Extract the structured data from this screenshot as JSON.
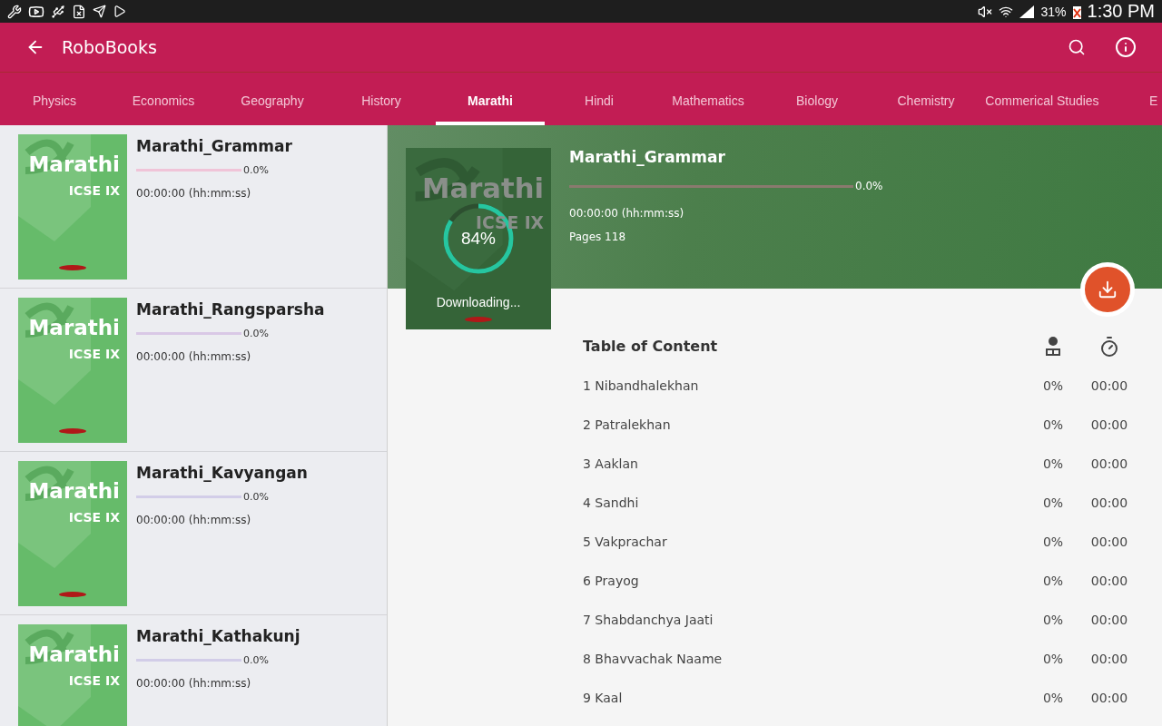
{
  "status_bar": {
    "battery": "31%",
    "time": "1:30 PM"
  },
  "app_bar": {
    "title": "RoboBooks"
  },
  "tabs": [
    {
      "label": "Physics",
      "selected": false
    },
    {
      "label": "Economics",
      "selected": false
    },
    {
      "label": "Geography",
      "selected": false
    },
    {
      "label": "History",
      "selected": false
    },
    {
      "label": "Marathi",
      "selected": true
    },
    {
      "label": "Hindi",
      "selected": false
    },
    {
      "label": "Mathematics",
      "selected": false
    },
    {
      "label": "Biology",
      "selected": false
    },
    {
      "label": "Chemistry",
      "selected": false
    },
    {
      "label": "Commerical Studies",
      "selected": false
    },
    {
      "label": "E",
      "selected": false
    }
  ],
  "books": [
    {
      "title": "Marathi_Grammar",
      "cover_title": "Marathi",
      "cover_subtitle": "ICSE IX",
      "level": 0,
      "progress": "0.0%",
      "color": "#f0c4d8",
      "time": "00:00:00 (hh:mm:ss)"
    },
    {
      "title": "Marathi_Rangsparsha",
      "cover_title": "Marathi",
      "cover_subtitle": "ICSE IX",
      "level": 0,
      "progress": "0.0%",
      "color": "#d9c8e6",
      "time": "00:00:00 (hh:mm:ss)"
    },
    {
      "title": "Marathi_Kavyangan",
      "cover_title": "Marathi",
      "cover_subtitle": "ICSE IX",
      "level": 0,
      "progress": "0.0%",
      "color": "#d2cde8",
      "time": "00:00:00 (hh:mm:ss)"
    },
    {
      "title": "Marathi_Kathakunj",
      "cover_title": "Marathi",
      "cover_subtitle": "ICSE IX",
      "level": 0,
      "progress": "0.0%",
      "color": "#d2cde8",
      "time": "00:00:00 (hh:mm:ss)"
    }
  ],
  "detail": {
    "title": "Marathi_Grammar",
    "cover_title": "Marathi",
    "cover_subtitle": "ICSE IX",
    "download": {
      "level": 0.84,
      "percent": "84%",
      "status": "Downloading..."
    },
    "level": 0,
    "progress": "0.0%",
    "time": "00:00:00 (hh:mm:ss)",
    "pages": "Pages 118",
    "toc": {
      "heading": "Table of Content",
      "rows": [
        {
          "title": "1 Nibandhalekhan",
          "percent": "0%",
          "time": "00:00"
        },
        {
          "title": "2 Patralekhan",
          "percent": "0%",
          "time": "00:00"
        },
        {
          "title": "3 Aaklan",
          "percent": "0%",
          "time": "00:00"
        },
        {
          "title": "4 Sandhi",
          "percent": "0%",
          "time": "00:00"
        },
        {
          "title": "5 Vakprachar",
          "percent": "0%",
          "time": "00:00"
        },
        {
          "title": "6 Prayog",
          "percent": "0%",
          "time": "00:00"
        },
        {
          "title": "7 Shabdanchya Jaati",
          "percent": "0%",
          "time": "00:00"
        },
        {
          "title": "8 Bhavvachak Naame",
          "percent": "0%",
          "time": "00:00"
        },
        {
          "title": "9 Kaal",
          "percent": "0%",
          "time": "00:00"
        }
      ]
    }
  }
}
